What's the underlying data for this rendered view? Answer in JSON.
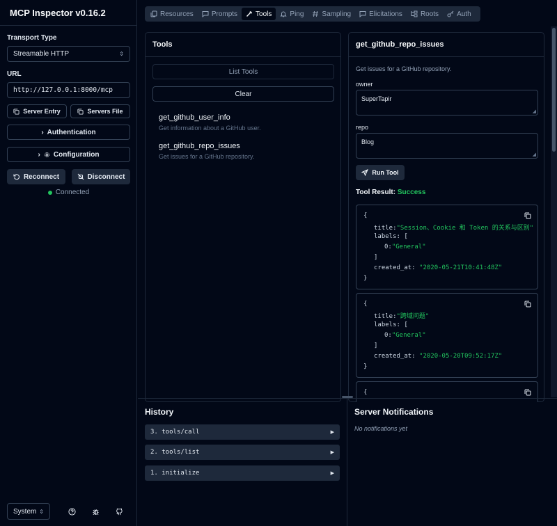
{
  "app": {
    "title": "MCP Inspector v0.16.2"
  },
  "sidebar": {
    "transport_label": "Transport Type",
    "transport_value": "Streamable HTTP",
    "url_label": "URL",
    "url_value": "http://127.0.0.1:8000/mcp",
    "server_entry_label": "Server Entry",
    "servers_file_label": "Servers File",
    "authentication_label": "Authentication",
    "configuration_label": "Configuration",
    "reconnect_label": "Reconnect",
    "disconnect_label": "Disconnect",
    "status_text": "Connected",
    "status_color": "#22c55e",
    "theme_value": "System"
  },
  "tabs": [
    {
      "label": "Resources",
      "icon": "files-icon"
    },
    {
      "label": "Prompts",
      "icon": "message-square-icon"
    },
    {
      "label": "Tools",
      "icon": "hammer-icon",
      "active": true
    },
    {
      "label": "Ping",
      "icon": "bell-icon"
    },
    {
      "label": "Sampling",
      "icon": "hash-icon"
    },
    {
      "label": "Elicitations",
      "icon": "message-square-icon"
    },
    {
      "label": "Roots",
      "icon": "folder-tree-icon"
    },
    {
      "label": "Auth",
      "icon": "key-icon"
    }
  ],
  "tools_panel": {
    "title": "Tools",
    "list_tools_label": "List Tools",
    "clear_label": "Clear",
    "items": [
      {
        "name": "get_github_user_info",
        "description": "Get information about a GitHub user."
      },
      {
        "name": "get_github_repo_issues",
        "description": "Get issues for a GitHub repository."
      }
    ]
  },
  "detail_panel": {
    "title": "get_github_repo_issues",
    "description": "Get issues for a GitHub repository.",
    "owner_label": "owner",
    "owner_value": "SuperTapir",
    "repo_label": "repo",
    "repo_value": "Blog",
    "run_label": "Run Tool",
    "result_label": "Tool Result:",
    "result_status": "Success",
    "results": [
      {
        "title": "\"Session、Cookie 和 Token 的关系与区别\"",
        "label0": "\"General\"",
        "created_at": "\"2020-05-21T10:41:48Z\""
      },
      {
        "title": "\"跨域问题\"",
        "label0": "\"General\"",
        "created_at": "\"2020-05-20T09:52:17Z\""
      }
    ],
    "keys": {
      "title": "title:",
      "labels": "labels:",
      "idx0": "0:",
      "created_at": "created_at:",
      "open_brace": "{",
      "close_brace": "}",
      "open_bracket": "[",
      "close_bracket": "]"
    }
  },
  "history": {
    "title": "History",
    "items": [
      {
        "label": "3. tools/call"
      },
      {
        "label": "2. tools/list"
      },
      {
        "label": "1. initialize"
      }
    ]
  },
  "notifications": {
    "title": "Server Notifications",
    "empty_text": "No notifications yet"
  }
}
